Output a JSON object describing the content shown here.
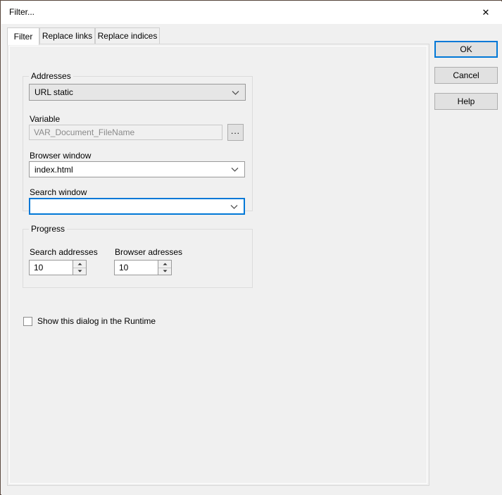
{
  "window": {
    "title": "Filter...",
    "close_icon": "close-icon"
  },
  "tabs": [
    {
      "label": "Filter",
      "selected": true
    },
    {
      "label": "Replace links",
      "selected": false
    },
    {
      "label": "Replace indices",
      "selected": false
    }
  ],
  "addresses_group": {
    "title": "Addresses",
    "type_combo": {
      "value": "URL static",
      "disabled": true,
      "arrow_icon": "chevron-down-icon"
    },
    "variable_label": "Variable",
    "variable_field": {
      "value": "VAR_Document_FileName",
      "readonly": true
    },
    "browse_button": "...",
    "browser_window_label": "Browser window",
    "browser_window_combo": {
      "value": "index.html",
      "arrow_icon": "chevron-down-icon"
    },
    "search_window_label": "Search window",
    "search_window_combo": {
      "value": "",
      "focused": true,
      "arrow_icon": "chevron-down-icon"
    }
  },
  "progress_group": {
    "title": "Progress",
    "search_addresses_label": "Search addresses",
    "search_addresses_value": "10",
    "browser_addresses_label": "Browser adresses",
    "browser_addresses_value": "10"
  },
  "show_dialog_checkbox": {
    "label": "Show this dialog in the Runtime",
    "checked": false
  },
  "buttons": {
    "ok": "OK",
    "cancel": "Cancel",
    "help": "Help"
  },
  "colors": {
    "accent": "#0078d7",
    "dialog_bg": "#f0f0f0",
    "panel_bg": "#f0f0f0",
    "field_bg": "#ffffff",
    "disabled_text": "#8a8a8a"
  }
}
